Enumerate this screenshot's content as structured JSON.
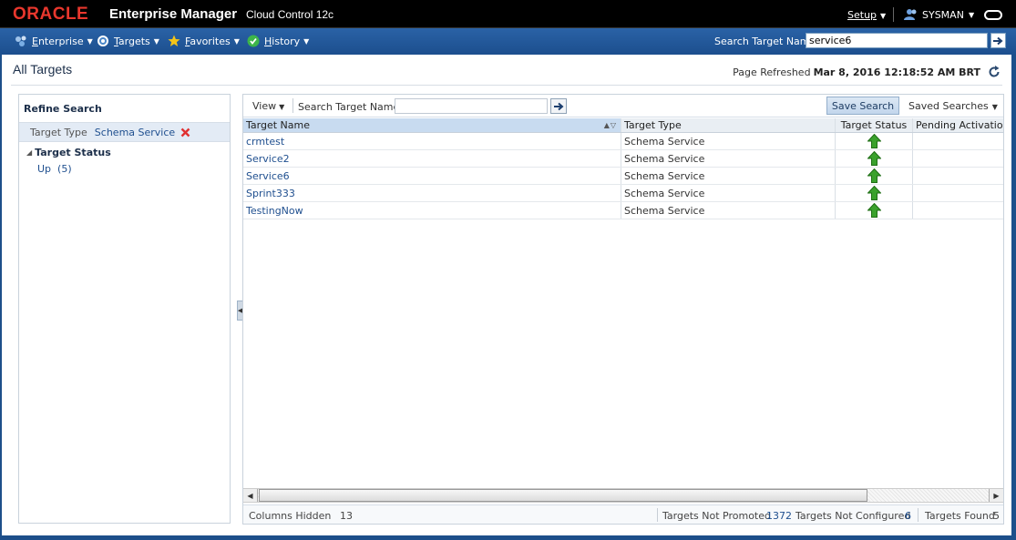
{
  "header": {
    "brand": "ORACLE",
    "product": "Enterprise Manager",
    "edition": "Cloud Control 12c",
    "setup_label": "Setup",
    "user_label": "SYSMAN"
  },
  "nav": {
    "items": [
      {
        "label": "Enterprise",
        "icon": "enterprise-icon"
      },
      {
        "label": "Targets",
        "icon": "targets-icon"
      },
      {
        "label": "Favorites",
        "icon": "star-icon"
      },
      {
        "label": "History",
        "icon": "history-icon"
      }
    ],
    "search_label": "Search Target Name",
    "search_value": "service6"
  },
  "page": {
    "title": "All Targets",
    "refresh_label": "Page Refreshed",
    "refresh_time": "Mar 8, 2016 12:18:52 AM BRT"
  },
  "refine": {
    "title": "Refine Search",
    "filter_label": "Target Type",
    "filter_value": "Schema Service",
    "status_header": "Target Status",
    "status_up": "Up  (5)"
  },
  "toolbar": {
    "view_label": "View",
    "search_label": "Search Target Name",
    "search_value": "",
    "save_search_label": "Save Search",
    "saved_searches_label": "Saved Searches"
  },
  "table": {
    "columns": [
      "Target Name",
      "Target Type",
      "Target Status",
      "Pending Activation"
    ],
    "rows": [
      {
        "name": "crmtest",
        "type": "Schema Service",
        "status": "up"
      },
      {
        "name": "Service2",
        "type": "Schema Service",
        "status": "up"
      },
      {
        "name": "Service6",
        "type": "Schema Service",
        "status": "up"
      },
      {
        "name": "Sprint333",
        "type": "Schema Service",
        "status": "up"
      },
      {
        "name": "TestingNow",
        "type": "Schema Service",
        "status": "up"
      }
    ]
  },
  "footer": {
    "columns_hidden_label": "Columns Hidden",
    "columns_hidden_value": "13",
    "not_promoted_label": "Targets Not Promoted",
    "not_promoted_value": "1372",
    "not_configured_label": "Targets Not Configured",
    "not_configured_value": "6",
    "found_label": "Targets Found",
    "found_value": "5"
  },
  "colors": {
    "oracle_red": "#e8372d",
    "nav_blue": "#1c4f8e",
    "link_blue": "#1f4f8f",
    "status_up_green": "#3aa12c"
  }
}
